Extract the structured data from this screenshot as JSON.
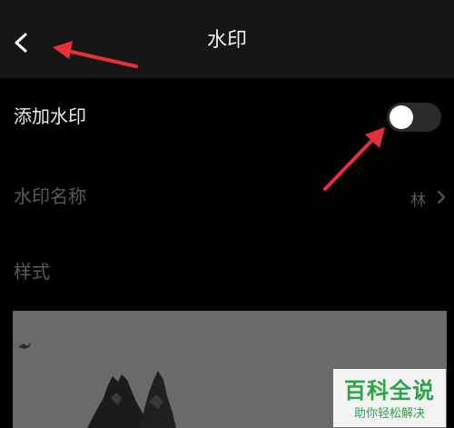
{
  "header": {
    "title": "水印",
    "back_icon": "chevron-left-icon"
  },
  "settings": {
    "add_watermark_label": "添加水印",
    "add_watermark_enabled": false,
    "watermark_name_label": "水印名称",
    "watermark_name_value": "林",
    "style_label": "样式"
  },
  "preview": {
    "image": "dark rock landscape preview"
  },
  "watermark_overlay": {
    "title": "百科全说",
    "subtitle": "助你轻松解决"
  },
  "colors": {
    "annotation_arrow": "#e8303a",
    "watermark_green": "#2aa34a"
  }
}
